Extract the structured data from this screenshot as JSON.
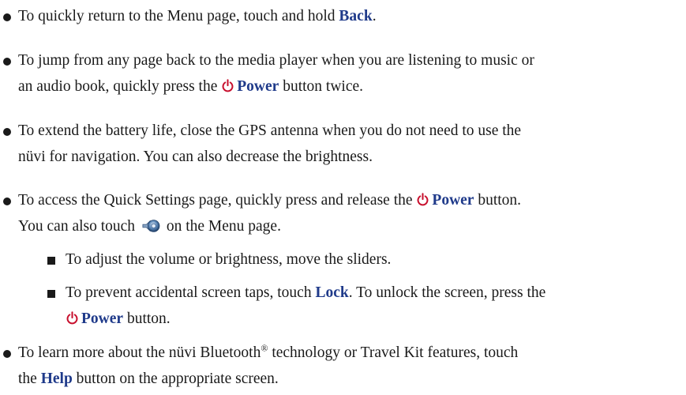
{
  "items": [
    {
      "pre": "To quickly return to the Menu page, touch and hold ",
      "kw": "Back",
      "post": "."
    },
    {
      "line1": "To jump from any page back to the media player when you are listening to music or",
      "line2_pre": "an audio book, quickly press the ",
      "kw": "Power",
      "line2_post": " button twice."
    },
    {
      "line1": "To extend the battery life, close the GPS antenna when you do not need to use the",
      "line2": "nüvi for navigation. You can also decrease the brightness."
    },
    {
      "line1_pre": "To access the Quick Settings page, quickly press and release the ",
      "kw": "Power",
      "line1_post": " button.",
      "line2_pre": "You can also touch ",
      "line2_post": " on the Menu page."
    },
    {
      "line1_pre": "To learn more about the nüvi Bluetooth",
      "sup": "®",
      "line1_post": " technology or Travel Kit features, touch",
      "line2_pre": "the ",
      "kw": "Help",
      "line2_post": " button on the appropriate screen."
    }
  ],
  "sub_items": [
    {
      "text": "To adjust the volume or brightness, move the sliders."
    },
    {
      "line1_pre": "To prevent accidental screen taps, touch ",
      "kw": "Lock",
      "line1_post": ". To unlock the screen, press the",
      "kw2": "Power",
      "line2_post": " button."
    }
  ],
  "icons": {
    "power": "power-icon",
    "quick_settings": "quick-settings-icon"
  },
  "colors": {
    "keyword": "#1f3a8a",
    "power_icon": "#c8102e",
    "text": "#1a1a1a"
  }
}
